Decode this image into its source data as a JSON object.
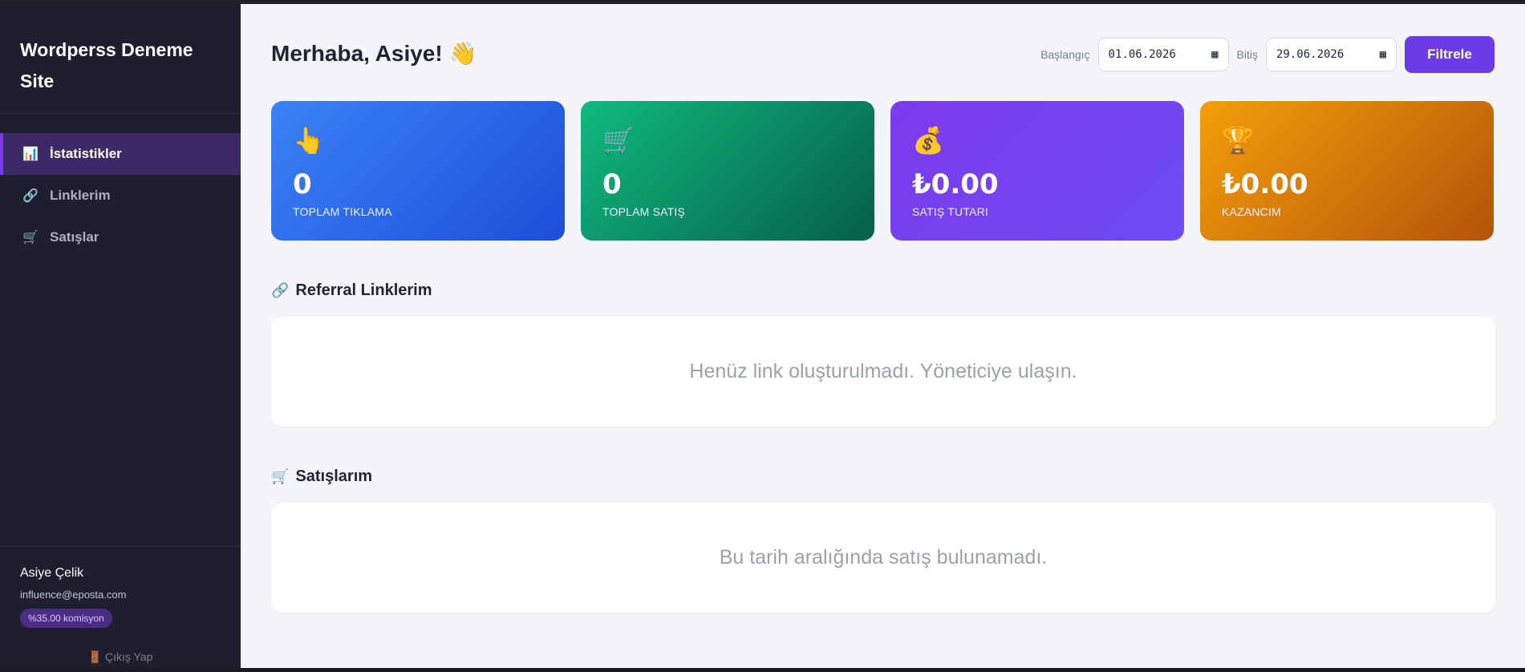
{
  "sidebar": {
    "brand": "Wordperss Deneme Site",
    "items": [
      {
        "label": "İstatistikler",
        "icon": "bar-chart-icon",
        "active": true
      },
      {
        "label": "Linklerim",
        "icon": "link-icon",
        "active": false
      },
      {
        "label": "Satışlar",
        "icon": "cart-icon",
        "active": false
      }
    ],
    "user": {
      "name": "Asiye Çelik",
      "email": "influence@eposta.com",
      "commission": "%35.00 komisyon"
    },
    "logout": "Çıkış Yap"
  },
  "header": {
    "greeting": "Merhaba, Asiye! 👋"
  },
  "filters": {
    "start_label": "Başlangıç",
    "start_value": "01.06.2026",
    "end_label": "Bitiş",
    "end_value": "29.06.2026",
    "button": "Filtrele"
  },
  "cards": [
    {
      "icon": "pointer-hand-icon",
      "glyph": "👆",
      "value": "0",
      "label": "TOPLAM TIKLAMA",
      "color": "#2563eb"
    },
    {
      "icon": "cart-icon",
      "glyph": "🛒",
      "value": "0",
      "label": "TOPLAM SATIŞ",
      "color": "#059669"
    },
    {
      "icon": "money-bag-icon",
      "glyph": "💰",
      "value": "₺0.00",
      "label": "SATIŞ TUTARI",
      "color": "#7c3aed"
    },
    {
      "icon": "trophy-icon",
      "glyph": "🏆",
      "value": "₺0.00",
      "label": "KAZANCIM",
      "color": "#d97706"
    }
  ],
  "links_section": {
    "title": "Referral Linklerim",
    "empty": "Henüz link oluşturulmadı. Yöneticiye ulaşın."
  },
  "sales_section": {
    "title": "Satışlarım",
    "empty": "Bu tarih aralığında satış bulunamadı."
  }
}
